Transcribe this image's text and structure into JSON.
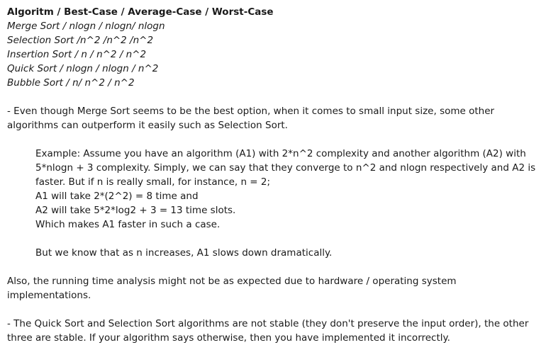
{
  "table": {
    "header": "Algoritm / Best-Case / Average-Case / Worst-Case",
    "rows": [
      "Merge Sort / nlogn / nlogn/ nlogn",
      "Selection Sort /n^2 /n^2 /n^2",
      "Insertion Sort / n / n^2 / n^2",
      "Quick Sort / nlogn / nlogn / n^2",
      "Bubble Sort / n/ n^2 / n^2"
    ]
  },
  "notes": {
    "merge_note": "- Even though Merge Sort seems to be the best option, when it comes to small input size, some other algorithms can outperform it easily such as Selection Sort.",
    "example": {
      "intro": "Example: Assume you have an algorithm (A1) with 2*n^2 complexity and another algorithm (A2) with 5*nlogn + 3 complexity. Simply, we can say that they converge to n^2 and nlogn respectively and A2 is faster. But if n is really small, for instance, n = 2;",
      "a1_line": "A1 will take 2*(2^2) = 8 time and",
      "a2_line": "A2 will take 5*2*log2 + 3 = 13 time slots.",
      "conclusion": "Which makes A1 faster in such a case.",
      "caveat": "But we know that as n increases, A1 slows down dramatically."
    },
    "hardware_note": "Also, the running time analysis might not be as expected due to hardware / operating system implementations.",
    "stability_note": "- The Quick Sort and Selection Sort algorithms are not stable (they don't preserve the input order), the other three are stable. If your algorithm says otherwise, then you have implemented it incorrectly."
  }
}
